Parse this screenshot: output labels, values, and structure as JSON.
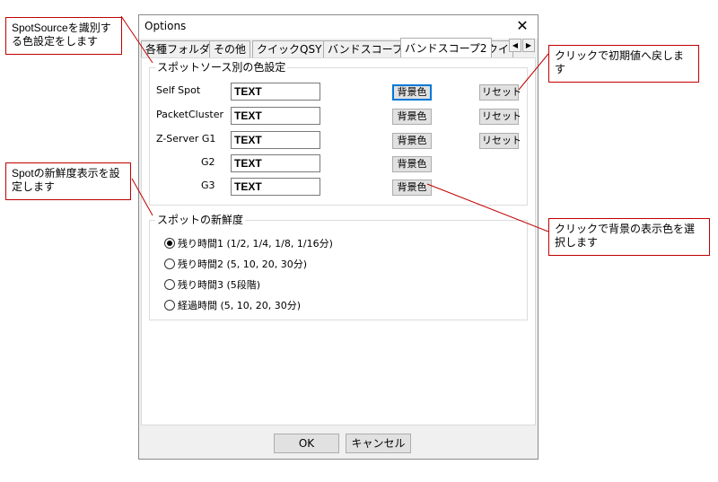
{
  "dialog": {
    "title": "Options",
    "close_glyph": "✕",
    "tabs": [
      "各種フォルダ",
      "その他",
      "クイックQSY",
      "バンドスコープ",
      "バンドスコープ2",
      "クイ"
    ],
    "tab_scroll_left": "◀",
    "tab_scroll_right": "▶",
    "ok_label": "OK",
    "cancel_label": "キャンセル"
  },
  "color_group": {
    "legend": "スポットソース別の色設定",
    "rows": [
      {
        "label": "Self Spot",
        "text": "TEXT",
        "bg_button": "背景色",
        "reset_button": "リセット"
      },
      {
        "label": "PacketCluster",
        "text": "TEXT",
        "bg_button": "背景色",
        "reset_button": "リセット"
      },
      {
        "label": "Z-Server G1",
        "text": "TEXT",
        "bg_button": "背景色",
        "reset_button": "リセット"
      },
      {
        "label": "G2",
        "text": "TEXT",
        "bg_button": "背景色"
      },
      {
        "label": "G3",
        "text": "TEXT",
        "bg_button": "背景色"
      }
    ]
  },
  "freshness_group": {
    "legend": "スポットの新鮮度",
    "options": [
      {
        "label": "残り時間1 (1/2, 1/4, 1/8, 1/16分)",
        "checked": true
      },
      {
        "label": "残り時間2 (5, 10, 20, 30分)",
        "checked": false
      },
      {
        "label": "残り時間3 (5段階)",
        "checked": false
      },
      {
        "label": "経過時間 (5, 10, 20, 30分)",
        "checked": false
      }
    ]
  },
  "callouts": {
    "spotsource": "SpotSourceを識別する色設定をします",
    "freshness": "Spotの新鮮度表示を設定します",
    "reset": "クリックで初期値へ戻します",
    "background": "クリックで背景の表示色を選択します"
  },
  "colors": {
    "callout_border": "#c00000",
    "focus_border": "#0078d7",
    "dialog_bg": "#f0f0f0"
  }
}
